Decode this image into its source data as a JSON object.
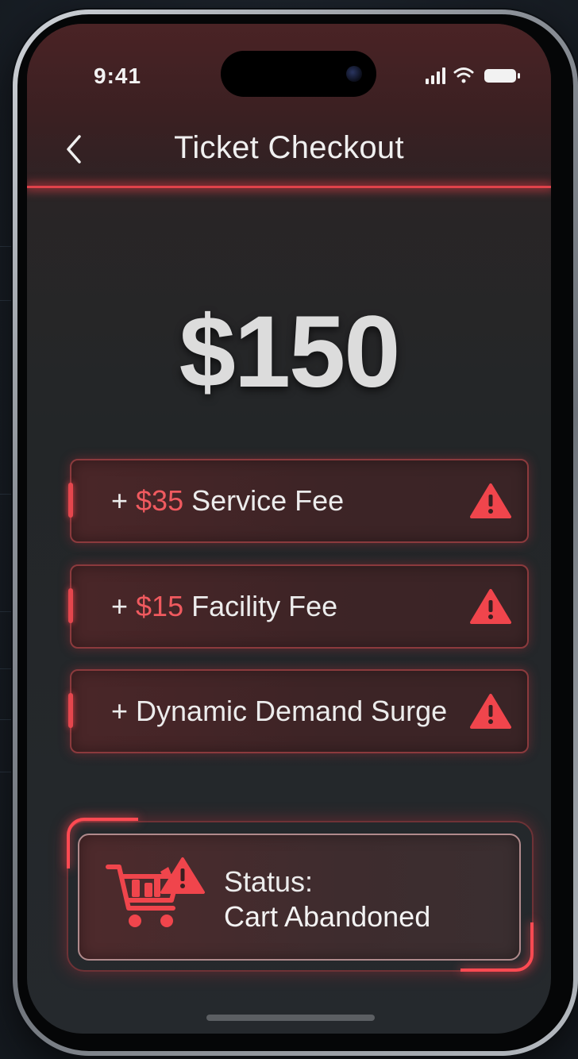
{
  "status_bar": {
    "time": "9:41"
  },
  "header": {
    "title": "Ticket Checkout",
    "back_icon": "chevron-left-icon"
  },
  "price": {
    "amount": "$150"
  },
  "fees": [
    {
      "prefix": "+ ",
      "amount": "$35",
      "label": " Service Fee",
      "icon": "warning-icon"
    },
    {
      "prefix": "+ ",
      "amount": "$15",
      "label": " Facility Fee",
      "icon": "warning-icon"
    },
    {
      "prefix": "+ ",
      "amount": "",
      "label": "Dynamic Demand Surge",
      "icon": "warning-icon"
    }
  ],
  "status": {
    "label": "Status:",
    "value": "Cart Abandoned",
    "icon": "cart-warning-icon"
  },
  "colors": {
    "accent_red": "#e5464d",
    "fee_amount": "#f05a5f",
    "text": "#ececec",
    "background": "#25292d"
  }
}
